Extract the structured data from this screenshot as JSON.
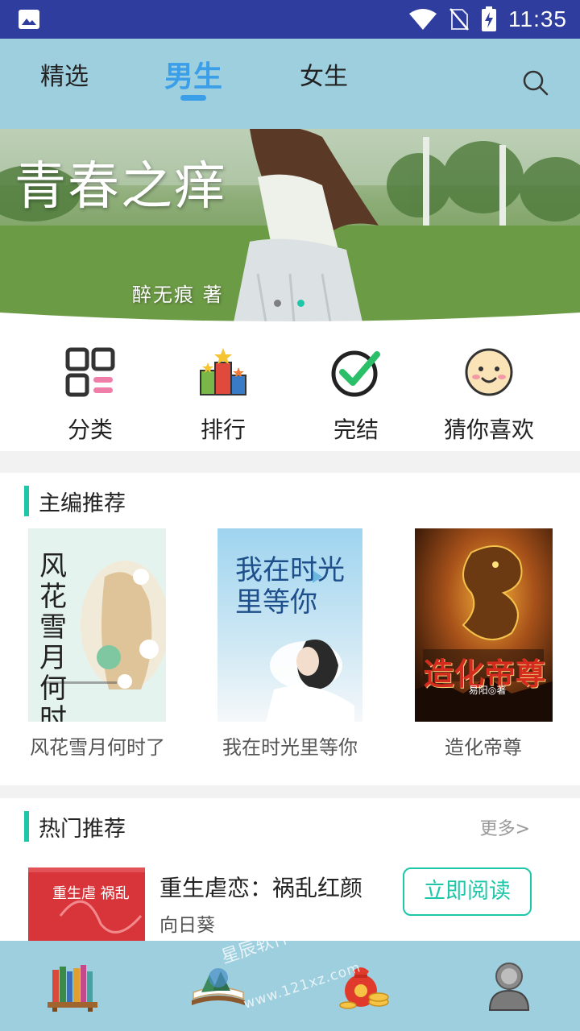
{
  "status_bar": {
    "time": "11:35"
  },
  "top_tabs": [
    {
      "label": "精选",
      "active": false
    },
    {
      "label": "男生",
      "active": true
    },
    {
      "label": "女生",
      "active": false
    }
  ],
  "banner": {
    "title": "青春之痒",
    "author_line": "醉无痕  著",
    "dot_count": 2,
    "active_dot": 2
  },
  "quick_entries": [
    {
      "label": "分类",
      "icon": "category-grid-icon"
    },
    {
      "label": "排行",
      "icon": "ranking-podium-icon"
    },
    {
      "label": "完结",
      "icon": "checkmark-circle-icon"
    },
    {
      "label": "猜你喜欢",
      "icon": "smiley-face-icon"
    }
  ],
  "editor_picks": {
    "title": "主编推荐",
    "books": [
      {
        "title": "风花雪月何时了",
        "cover_text": "风花雪月何时了"
      },
      {
        "title": "我在时光里等你",
        "cover_text": "我在时光里等你"
      },
      {
        "title": "造化帝尊",
        "cover_text": "造化帝尊",
        "cover_author": "易阳◎著"
      }
    ]
  },
  "hot_picks": {
    "title": "热门推荐",
    "more_label": "更多>",
    "item": {
      "title": "重生虐恋：祸乱红颜",
      "author": "向日葵",
      "cover_text": "重生虐 祸乱",
      "action_label": "立即阅读"
    }
  },
  "bottom_nav": [
    {
      "icon": "bookshelf-icon"
    },
    {
      "icon": "bookstore-icon"
    },
    {
      "icon": "money-bag-icon"
    },
    {
      "icon": "profile-avatar-icon"
    }
  ],
  "watermark": {
    "line1": "星辰软件",
    "line2": "www.121xz.com"
  },
  "colors": {
    "accent": "#1ec7a8",
    "tab_active": "#3a9ee8",
    "nav_bg": "#9ecfdf",
    "status_bg": "#2f3e9e"
  }
}
